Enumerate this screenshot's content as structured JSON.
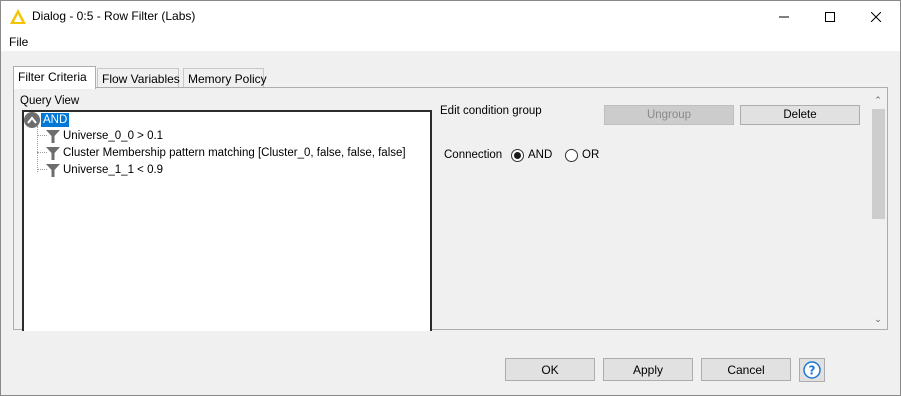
{
  "window": {
    "title": "Dialog - 0:5 - Row Filter (Labs)"
  },
  "menu": {
    "file": "File"
  },
  "tabs": [
    {
      "label": "Filter Criteria",
      "active": true
    },
    {
      "label": "Flow Variables",
      "active": false
    },
    {
      "label": "Memory Policy",
      "active": false
    }
  ],
  "query_view": {
    "label": "Query View",
    "root": "AND",
    "children": [
      "Universe_0_0 > 0.1",
      "Cluster Membership pattern matching [Cluster_0, false, false, false]",
      "Universe_1_1 < 0.9"
    ]
  },
  "edit_group": {
    "label": "Edit condition group",
    "ungroup_label": "Ungroup",
    "delete_label": "Delete",
    "connection_label": "Connection",
    "options": [
      "AND",
      "OR"
    ],
    "selected": "AND"
  },
  "buttons": {
    "ok": "OK",
    "apply": "Apply",
    "cancel": "Cancel",
    "help_icon": "help-icon"
  },
  "colors": {
    "selection": "#0078d7",
    "app_icon": "#f5c400"
  }
}
